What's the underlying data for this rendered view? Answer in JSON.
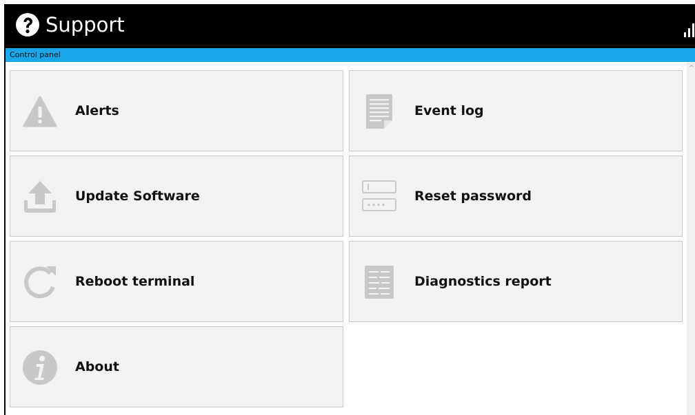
{
  "header": {
    "title": "Support",
    "breadcrumb": "Control panel",
    "title_bar_color": "#000000",
    "breadcrumb_bar_color": "#1aa7ea",
    "icons": [
      "help-icon",
      "signal-strength-icon"
    ]
  },
  "tiles": [
    {
      "label": "Alerts",
      "icon": "alert-triangle-icon"
    },
    {
      "label": "Event log",
      "icon": "document-icon"
    },
    {
      "label": "Update Software",
      "icon": "upload-icon"
    },
    {
      "label": "Reset password",
      "icon": "password-field-icon"
    },
    {
      "label": "Reboot terminal",
      "icon": "refresh-icon"
    },
    {
      "label": "Diagnostics report",
      "icon": "report-icon"
    },
    {
      "label": "About",
      "icon": "info-icon"
    }
  ],
  "colors": {
    "tile_background": "#f2f2f2",
    "icon_gray": "#c8c8c8"
  }
}
